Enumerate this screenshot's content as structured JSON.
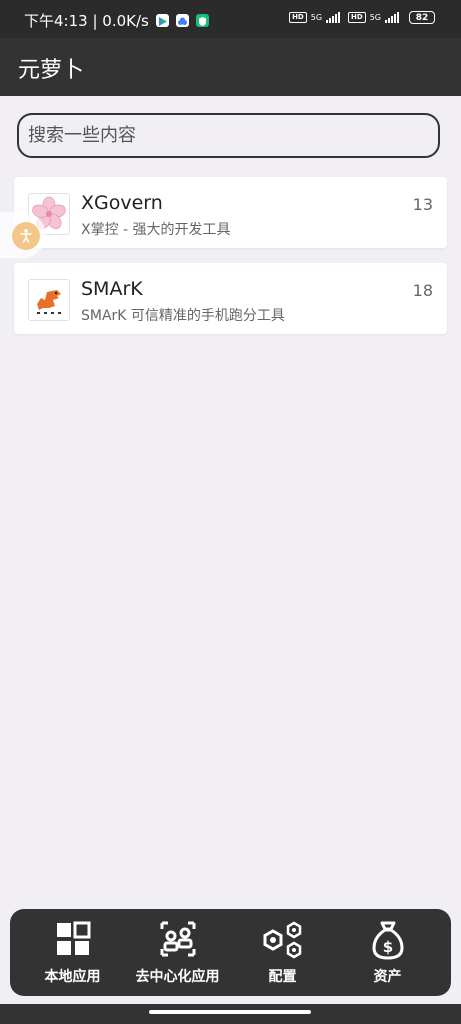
{
  "status_bar": {
    "time_speed": "下午4:13 | 0.0K/s",
    "network_1": "5G",
    "network_2": "5G",
    "battery": "82"
  },
  "app_bar": {
    "title": "元萝卜"
  },
  "search": {
    "placeholder": "搜索一些内容"
  },
  "apps": [
    {
      "name": "XGovern",
      "description": "X掌控 - 强大的开发工具",
      "count": "13",
      "icon": "sakura-flower-icon"
    },
    {
      "name": "SMArK",
      "description": "SMArK 可信精准的手机跑分工具",
      "count": "18",
      "icon": "dinosaur-logo-icon"
    }
  ],
  "bottom_nav": {
    "items": [
      {
        "label": "本地应用",
        "icon": "grid-apps-icon"
      },
      {
        "label": "去中心化应用",
        "icon": "decentralized-users-icon"
      },
      {
        "label": "配置",
        "icon": "settings-hexagons-icon"
      },
      {
        "label": "资产",
        "icon": "money-bag-icon"
      }
    ]
  },
  "colors": {
    "bar": "#333333",
    "background": "#f1eff4",
    "card": "#ffffff",
    "float_button": "#f3c78a"
  }
}
